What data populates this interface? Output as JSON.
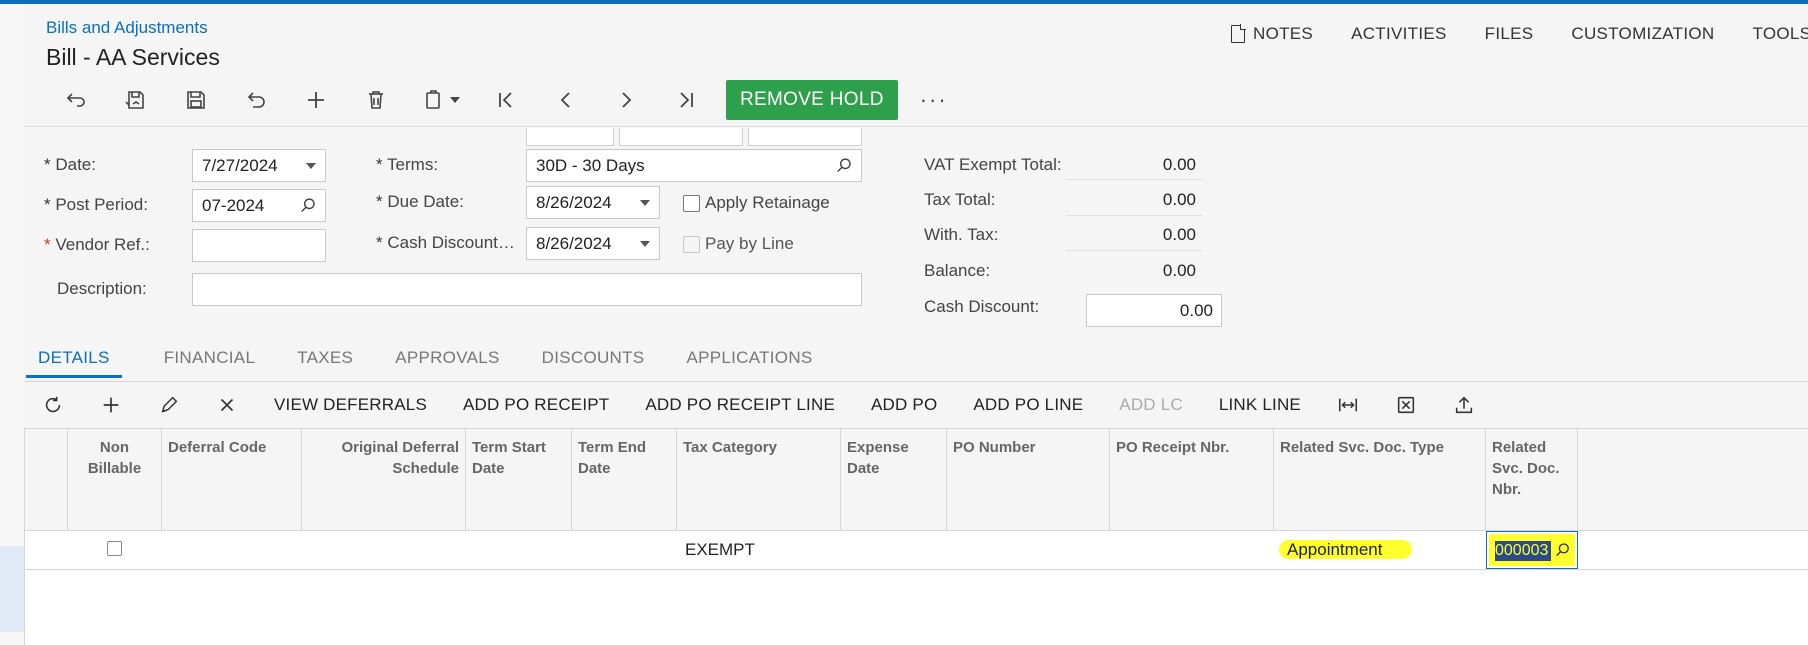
{
  "breadcrumb": "Bills and Adjustments",
  "title": "Bill - AA Services",
  "topnav": {
    "notes": "NOTES",
    "activities": "ACTIVITIES",
    "files": "FILES",
    "customization": "CUSTOMIZATION",
    "tools": "TOOLS"
  },
  "toolbar": {
    "icons": [
      "undo-back-icon",
      "save-close-icon",
      "save-icon",
      "cancel-icon",
      "add-icon",
      "delete-icon",
      "copy-paste-icon",
      "first-icon",
      "previous-icon",
      "next-icon",
      "last-icon"
    ],
    "remove_hold": "REMOVE HOLD",
    "more": "···"
  },
  "form": {
    "date_label": "Date:",
    "date_value": "7/27/2024",
    "post_period_label": "Post Period:",
    "post_period_value": "07-2024",
    "vendor_ref_label": "Vendor Ref.:",
    "vendor_ref_value": "",
    "description_label": "Description:",
    "description_value": "",
    "terms_label": "Terms:",
    "terms_value": "30D - 30 Days",
    "due_date_label": "Due Date:",
    "due_date_value": "8/26/2024",
    "cash_discount_label": "Cash Discount…",
    "cash_discount_value": "8/26/2024",
    "apply_retainage_label": "Apply Retainage",
    "apply_retainage_checked": false,
    "pay_by_line_label": "Pay by Line",
    "pay_by_line_checked": false
  },
  "totals": {
    "vat_exempt_label": "VAT Exempt Total:",
    "vat_exempt_value": "0.00",
    "tax_total_label": "Tax Total:",
    "tax_total_value": "0.00",
    "with_tax_label": "With. Tax:",
    "with_tax_value": "0.00",
    "balance_label": "Balance:",
    "balance_value": "0.00",
    "cash_discount_label": "Cash Discount:",
    "cash_discount_value": "0.00"
  },
  "tabs": [
    "DETAILS",
    "FINANCIAL",
    "TAXES",
    "APPROVALS",
    "DISCOUNTS",
    "APPLICATIONS"
  ],
  "active_tab": "DETAILS",
  "grid_toolbar": {
    "view_deferrals": "VIEW DEFERRALS",
    "add_po_receipt": "ADD PO RECEIPT",
    "add_po_receipt_line": "ADD PO RECEIPT LINE",
    "add_po": "ADD PO",
    "add_po_line": "ADD PO LINE",
    "add_lc": "ADD LC",
    "link_line": "LINK LINE"
  },
  "grid": {
    "headers": {
      "non_billable": "Non Billable",
      "deferral_code": "Deferral Code",
      "original_deferral_schedule": "Original Deferral Schedule",
      "term_start_date": "Term Start Date",
      "term_end_date": "Term End Date",
      "tax_category": "Tax Category",
      "expense_date": "Expense Date",
      "po_number": "PO Number",
      "po_receipt_nbr": "PO Receipt Nbr.",
      "related_svc_doc_type": "Related Svc. Doc. Type",
      "related_svc_doc_nbr": "Related Svc. Doc. Nbr."
    },
    "rows": [
      {
        "non_billable": false,
        "tax_category": "EXEMPT",
        "related_svc_doc_type": "Appointment",
        "related_svc_doc_nbr": "000003"
      }
    ]
  },
  "colors": {
    "accent": "#0a6fbf",
    "green_button": "#2ea04c",
    "highlight": "#ffff2e"
  }
}
